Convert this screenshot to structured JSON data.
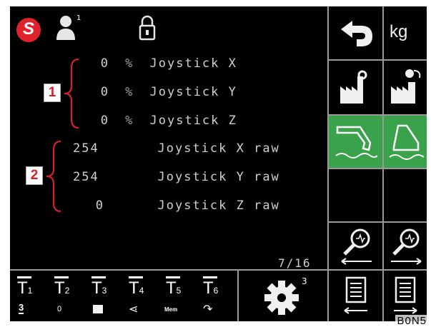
{
  "header": {
    "logo_letter": "S",
    "user_badge": "1"
  },
  "readings_group_1": {
    "marker": "1",
    "rows": [
      {
        "value": "0",
        "unit": "%",
        "label": "Joystick X"
      },
      {
        "value": "0",
        "unit": "%",
        "label": "Joystick Y"
      },
      {
        "value": "0",
        "unit": "%",
        "label": "Joystick Z"
      }
    ]
  },
  "readings_group_2": {
    "marker": "2",
    "rows": [
      {
        "value": "254",
        "label": "Joystick X raw"
      },
      {
        "value": "254",
        "label": "Joystick Y raw"
      },
      {
        "value": "0",
        "label": "Joystick Z raw"
      }
    ]
  },
  "page_indicator": "7/16",
  "side_panel": {
    "unit_button": "kg"
  },
  "toolbar": {
    "tools": [
      {
        "label": "1",
        "sub": "3"
      },
      {
        "label": "2",
        "sub": "0"
      },
      {
        "label": "3",
        "sub": ""
      },
      {
        "label": "4",
        "sub": ""
      },
      {
        "label": "5",
        "sub": "Mem"
      },
      {
        "label": "6",
        "sub": ""
      }
    ],
    "settings_badge": "3"
  },
  "watermark": "B0N5",
  "colors": {
    "background": "#000000",
    "accent_red": "#d2232a",
    "active_green": "#3aa24a",
    "text": "#cfcfcf"
  }
}
